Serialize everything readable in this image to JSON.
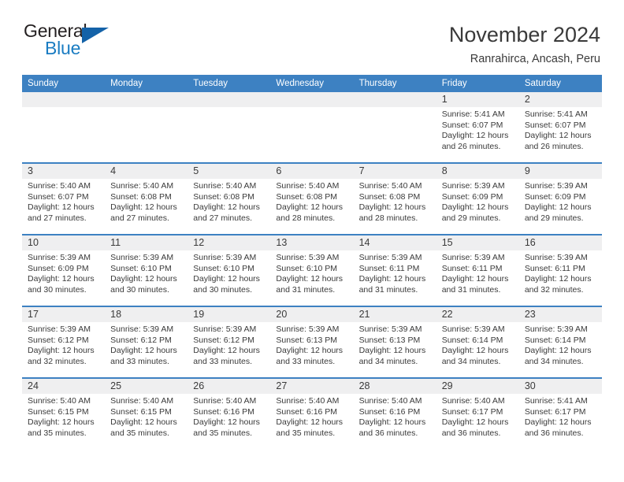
{
  "brand": {
    "name_part1": "General",
    "name_part2": "Blue",
    "triangle_icon": "triangle-icon",
    "accent_color": "#1a7cc2"
  },
  "header": {
    "title": "November 2024",
    "subtitle": "Ranrahirca, Ancash, Peru"
  },
  "calendar": {
    "header_color": "#3d81c2",
    "daynum_band_color": "#efeff0",
    "weekdays": [
      "Sunday",
      "Monday",
      "Tuesday",
      "Wednesday",
      "Thursday",
      "Friday",
      "Saturday"
    ],
    "weeks": [
      [
        {
          "day": "",
          "empty": true
        },
        {
          "day": "",
          "empty": true
        },
        {
          "day": "",
          "empty": true
        },
        {
          "day": "",
          "empty": true
        },
        {
          "day": "",
          "empty": true
        },
        {
          "day": "1",
          "sunrise": "Sunrise: 5:41 AM",
          "sunset": "Sunset: 6:07 PM",
          "daylight1": "Daylight: 12 hours",
          "daylight2": "and 26 minutes."
        },
        {
          "day": "2",
          "sunrise": "Sunrise: 5:41 AM",
          "sunset": "Sunset: 6:07 PM",
          "daylight1": "Daylight: 12 hours",
          "daylight2": "and 26 minutes."
        }
      ],
      [
        {
          "day": "3",
          "sunrise": "Sunrise: 5:40 AM",
          "sunset": "Sunset: 6:07 PM",
          "daylight1": "Daylight: 12 hours",
          "daylight2": "and 27 minutes."
        },
        {
          "day": "4",
          "sunrise": "Sunrise: 5:40 AM",
          "sunset": "Sunset: 6:08 PM",
          "daylight1": "Daylight: 12 hours",
          "daylight2": "and 27 minutes."
        },
        {
          "day": "5",
          "sunrise": "Sunrise: 5:40 AM",
          "sunset": "Sunset: 6:08 PM",
          "daylight1": "Daylight: 12 hours",
          "daylight2": "and 27 minutes."
        },
        {
          "day": "6",
          "sunrise": "Sunrise: 5:40 AM",
          "sunset": "Sunset: 6:08 PM",
          "daylight1": "Daylight: 12 hours",
          "daylight2": "and 28 minutes."
        },
        {
          "day": "7",
          "sunrise": "Sunrise: 5:40 AM",
          "sunset": "Sunset: 6:08 PM",
          "daylight1": "Daylight: 12 hours",
          "daylight2": "and 28 minutes."
        },
        {
          "day": "8",
          "sunrise": "Sunrise: 5:39 AM",
          "sunset": "Sunset: 6:09 PM",
          "daylight1": "Daylight: 12 hours",
          "daylight2": "and 29 minutes."
        },
        {
          "day": "9",
          "sunrise": "Sunrise: 5:39 AM",
          "sunset": "Sunset: 6:09 PM",
          "daylight1": "Daylight: 12 hours",
          "daylight2": "and 29 minutes."
        }
      ],
      [
        {
          "day": "10",
          "sunrise": "Sunrise: 5:39 AM",
          "sunset": "Sunset: 6:09 PM",
          "daylight1": "Daylight: 12 hours",
          "daylight2": "and 30 minutes."
        },
        {
          "day": "11",
          "sunrise": "Sunrise: 5:39 AM",
          "sunset": "Sunset: 6:10 PM",
          "daylight1": "Daylight: 12 hours",
          "daylight2": "and 30 minutes."
        },
        {
          "day": "12",
          "sunrise": "Sunrise: 5:39 AM",
          "sunset": "Sunset: 6:10 PM",
          "daylight1": "Daylight: 12 hours",
          "daylight2": "and 30 minutes."
        },
        {
          "day": "13",
          "sunrise": "Sunrise: 5:39 AM",
          "sunset": "Sunset: 6:10 PM",
          "daylight1": "Daylight: 12 hours",
          "daylight2": "and 31 minutes."
        },
        {
          "day": "14",
          "sunrise": "Sunrise: 5:39 AM",
          "sunset": "Sunset: 6:11 PM",
          "daylight1": "Daylight: 12 hours",
          "daylight2": "and 31 minutes."
        },
        {
          "day": "15",
          "sunrise": "Sunrise: 5:39 AM",
          "sunset": "Sunset: 6:11 PM",
          "daylight1": "Daylight: 12 hours",
          "daylight2": "and 31 minutes."
        },
        {
          "day": "16",
          "sunrise": "Sunrise: 5:39 AM",
          "sunset": "Sunset: 6:11 PM",
          "daylight1": "Daylight: 12 hours",
          "daylight2": "and 32 minutes."
        }
      ],
      [
        {
          "day": "17",
          "sunrise": "Sunrise: 5:39 AM",
          "sunset": "Sunset: 6:12 PM",
          "daylight1": "Daylight: 12 hours",
          "daylight2": "and 32 minutes."
        },
        {
          "day": "18",
          "sunrise": "Sunrise: 5:39 AM",
          "sunset": "Sunset: 6:12 PM",
          "daylight1": "Daylight: 12 hours",
          "daylight2": "and 33 minutes."
        },
        {
          "day": "19",
          "sunrise": "Sunrise: 5:39 AM",
          "sunset": "Sunset: 6:12 PM",
          "daylight1": "Daylight: 12 hours",
          "daylight2": "and 33 minutes."
        },
        {
          "day": "20",
          "sunrise": "Sunrise: 5:39 AM",
          "sunset": "Sunset: 6:13 PM",
          "daylight1": "Daylight: 12 hours",
          "daylight2": "and 33 minutes."
        },
        {
          "day": "21",
          "sunrise": "Sunrise: 5:39 AM",
          "sunset": "Sunset: 6:13 PM",
          "daylight1": "Daylight: 12 hours",
          "daylight2": "and 34 minutes."
        },
        {
          "day": "22",
          "sunrise": "Sunrise: 5:39 AM",
          "sunset": "Sunset: 6:14 PM",
          "daylight1": "Daylight: 12 hours",
          "daylight2": "and 34 minutes."
        },
        {
          "day": "23",
          "sunrise": "Sunrise: 5:39 AM",
          "sunset": "Sunset: 6:14 PM",
          "daylight1": "Daylight: 12 hours",
          "daylight2": "and 34 minutes."
        }
      ],
      [
        {
          "day": "24",
          "sunrise": "Sunrise: 5:40 AM",
          "sunset": "Sunset: 6:15 PM",
          "daylight1": "Daylight: 12 hours",
          "daylight2": "and 35 minutes."
        },
        {
          "day": "25",
          "sunrise": "Sunrise: 5:40 AM",
          "sunset": "Sunset: 6:15 PM",
          "daylight1": "Daylight: 12 hours",
          "daylight2": "and 35 minutes."
        },
        {
          "day": "26",
          "sunrise": "Sunrise: 5:40 AM",
          "sunset": "Sunset: 6:16 PM",
          "daylight1": "Daylight: 12 hours",
          "daylight2": "and 35 minutes."
        },
        {
          "day": "27",
          "sunrise": "Sunrise: 5:40 AM",
          "sunset": "Sunset: 6:16 PM",
          "daylight1": "Daylight: 12 hours",
          "daylight2": "and 35 minutes."
        },
        {
          "day": "28",
          "sunrise": "Sunrise: 5:40 AM",
          "sunset": "Sunset: 6:16 PM",
          "daylight1": "Daylight: 12 hours",
          "daylight2": "and 36 minutes."
        },
        {
          "day": "29",
          "sunrise": "Sunrise: 5:40 AM",
          "sunset": "Sunset: 6:17 PM",
          "daylight1": "Daylight: 12 hours",
          "daylight2": "and 36 minutes."
        },
        {
          "day": "30",
          "sunrise": "Sunrise: 5:41 AM",
          "sunset": "Sunset: 6:17 PM",
          "daylight1": "Daylight: 12 hours",
          "daylight2": "and 36 minutes."
        }
      ]
    ]
  }
}
